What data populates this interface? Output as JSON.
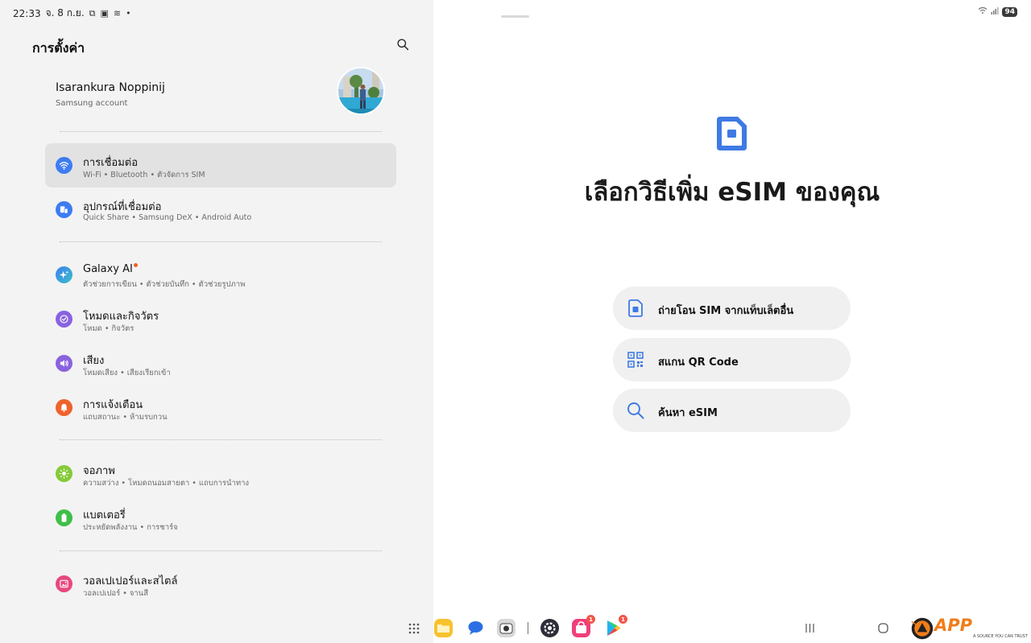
{
  "status_bar": {
    "time": "22:33",
    "date": "จ. 8 ก.ย.",
    "battery": "94"
  },
  "settings": {
    "title": "การตั้งค่า",
    "account": {
      "name": "Isarankura Noppinij",
      "subtitle": "Samsung account"
    },
    "items": [
      {
        "title": "การเชื่อมต่อ",
        "subtitle": "Wi-Fi  •  Bluetooth  •  ตัวจัดการ SIM",
        "icon": "wifi-icon",
        "color": "#3d7cf2",
        "active": true
      },
      {
        "title": "อุปกรณ์ที่เชื่อมต่อ",
        "subtitle": "Quick Share  •  Samsung DeX  •  Android Auto",
        "icon": "devices-icon",
        "color": "#3d7cf2",
        "active": false
      },
      {
        "title": "Galaxy AI",
        "subtitle": "ตัวช่วยการเขียน  •  ตัวช่วยบันทึก  •  ตัวช่วยรูปภาพ",
        "icon": "sparkle-icon",
        "color": "#3f7df0",
        "active": false
      },
      {
        "title": "โหมดและกิจวัตร",
        "subtitle": "โหมด  •  กิจวัตร",
        "icon": "routine-icon",
        "color": "#8a62e0",
        "active": false
      },
      {
        "title": "เสียง",
        "subtitle": "โหมดเสียง  •  เสียงเรียกเข้า",
        "icon": "sound-icon",
        "color": "#8a62e0",
        "active": false
      },
      {
        "title": "การแจ้งเตือน",
        "subtitle": "แถบสถานะ  •  ห้ามรบกวน",
        "icon": "bell-icon",
        "color": "#f0622b",
        "active": false
      },
      {
        "title": "จอภาพ",
        "subtitle": "ความสว่าง  •  โหมดถนอมสายตา  •  แถบการนำทาง",
        "icon": "sun-icon",
        "color": "#86c93a",
        "active": false
      },
      {
        "title": "แบตเตอรี่",
        "subtitle": "ประหยัดพลังงาน  •  การชาร์จ",
        "icon": "battery-icon",
        "color": "#3fbf4a",
        "active": false
      },
      {
        "title": "วอลเปเปอร์และสไตล์",
        "subtitle": "วอลเปเปอร์  •  จานสี",
        "icon": "wallpaper-icon",
        "color": "#e8487c",
        "active": false
      }
    ]
  },
  "esim": {
    "heading": "เลือกวิธีเพิ่ม eSIM ของคุณ",
    "options": [
      {
        "label": "ถ่ายโอน SIM จากแท็บเล็ตอื่น",
        "icon": "sim-card-icon"
      },
      {
        "label": "สแกน QR Code",
        "icon": "qr-code-icon"
      },
      {
        "label": "ค้นหา eSIM",
        "icon": "search-icon"
      }
    ],
    "accent": "#3f7ae4"
  },
  "taskbar": {
    "apps": [
      {
        "name": "apps-grid-icon"
      },
      {
        "name": "my-files-icon"
      },
      {
        "name": "messages-icon"
      },
      {
        "name": "camera-icon"
      },
      {
        "name": "settings-icon"
      },
      {
        "name": "galaxy-store-icon",
        "badge": "1"
      },
      {
        "name": "play-store-icon",
        "badge": "1"
      }
    ],
    "watermark": {
      "text": "APP",
      "tagline": "A SOURCE YOU CAN TRUST"
    }
  }
}
